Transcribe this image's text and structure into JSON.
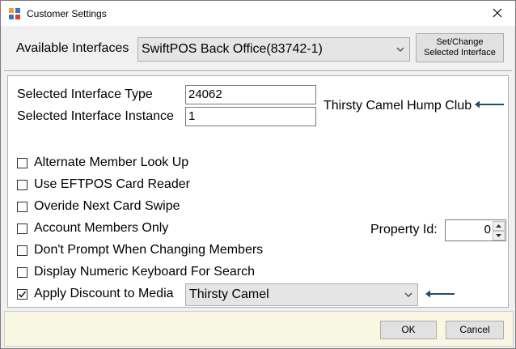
{
  "window": {
    "title": "Customer Settings"
  },
  "top": {
    "available_label": "Available Interfaces",
    "available_value": "SwiftPOS Back Office(83742-1)",
    "set_change_line1": "Set/Change",
    "set_change_line2": "Selected Interface"
  },
  "main": {
    "type_label": "Selected Interface Type",
    "type_value": "24062",
    "instance_label": "Selected Interface Instance",
    "instance_value": "1",
    "club_name": "Thirsty Camel Hump Club",
    "options": [
      {
        "label": "Alternate Member Look Up",
        "checked": false
      },
      {
        "label": "Use EFTPOS Card Reader",
        "checked": false
      },
      {
        "label": "Overide Next Card Swipe",
        "checked": false
      },
      {
        "label": "Account Members Only",
        "checked": false
      },
      {
        "label": "Don't Prompt When Changing Members",
        "checked": false
      },
      {
        "label": "Display Numeric Keyboard For Search",
        "checked": false
      },
      {
        "label": "Apply Discount to Media",
        "checked": true
      }
    ],
    "property_label": "Property Id:",
    "property_value": "0",
    "media_value": "Thirsty Camel"
  },
  "footer": {
    "ok_label": "OK",
    "cancel_label": "Cancel"
  },
  "colors": {
    "arrow": "#1f4e6b",
    "bottom_bar": "#f7f7e4"
  }
}
